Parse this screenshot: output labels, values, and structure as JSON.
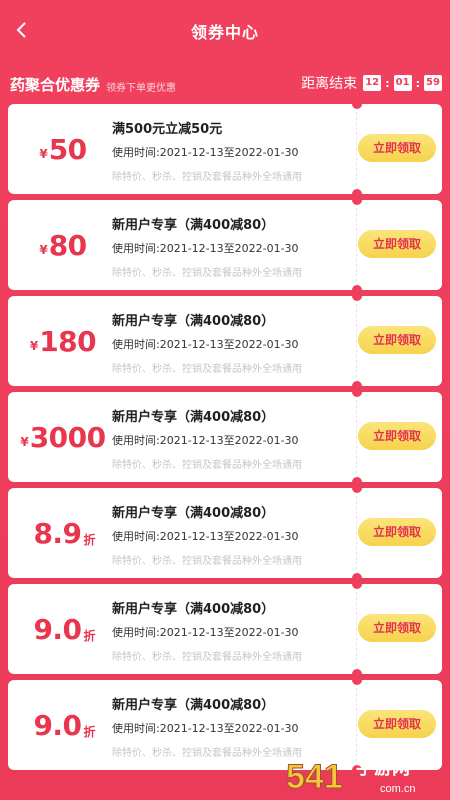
{
  "header": {
    "title": "领券中心"
  },
  "subbar": {
    "title": "药聚合优惠券",
    "hint": "领券下单更优惠",
    "countdown_label": "距离结束",
    "hours": "12",
    "minutes": "01",
    "seconds": "59",
    "sep1": ":",
    "sep2": ":"
  },
  "coupons": [
    {
      "currency": "¥",
      "amount": "50",
      "unit": "",
      "title": "满500元立减50元",
      "time": "使用时间:2021-12-13至2022-01-30",
      "note": "除特价、秒杀、控销及套餐品种外全场通用",
      "button": "立即领取"
    },
    {
      "currency": "¥",
      "amount": "80",
      "unit": "",
      "title": "新用户专享（满400减80）",
      "time": "使用时间:2021-12-13至2022-01-30",
      "note": "除特价、秒杀、控销及套餐品种外全场通用",
      "button": "立即领取"
    },
    {
      "currency": "¥",
      "amount": "180",
      "unit": "",
      "title": "新用户专享（满400减80）",
      "time": "使用时间:2021-12-13至2022-01-30",
      "note": "除特价、秒杀、控销及套餐品种外全场通用",
      "button": "立即领取"
    },
    {
      "currency": "¥",
      "amount": "3000",
      "unit": "",
      "title": "新用户专享（满400减80）",
      "time": "使用时间:2021-12-13至2022-01-30",
      "note": "除特价、秒杀、控销及套餐品种外全场通用",
      "button": "立即领取"
    },
    {
      "currency": "",
      "amount": "8.9",
      "unit": "折",
      "title": "新用户专享（满400减80）",
      "time": "使用时间:2021-12-13至2022-01-30",
      "note": "除特价、秒杀、控销及套餐品种外全场通用",
      "button": "立即领取"
    },
    {
      "currency": "",
      "amount": "9.0",
      "unit": "折",
      "title": "新用户专享（满400减80）",
      "time": "使用时间:2021-12-13至2022-01-30",
      "note": "除特价、秒杀、控销及套餐品种外全场通用",
      "button": "立即领取"
    },
    {
      "currency": "",
      "amount": "9.0",
      "unit": "折",
      "title": "新用户专享（满400减80）",
      "time": "使用时间:2021-12-13至2022-01-30",
      "note": "除特价、秒杀、控销及套餐品种外全场通用",
      "button": "立即领取"
    }
  ],
  "watermark": {
    "number": "541",
    "text": "手游网",
    "domain": "com.cn"
  },
  "colors": {
    "background": "#ee3e5c",
    "accent": "#e8364f",
    "button": "#f6d24c"
  }
}
